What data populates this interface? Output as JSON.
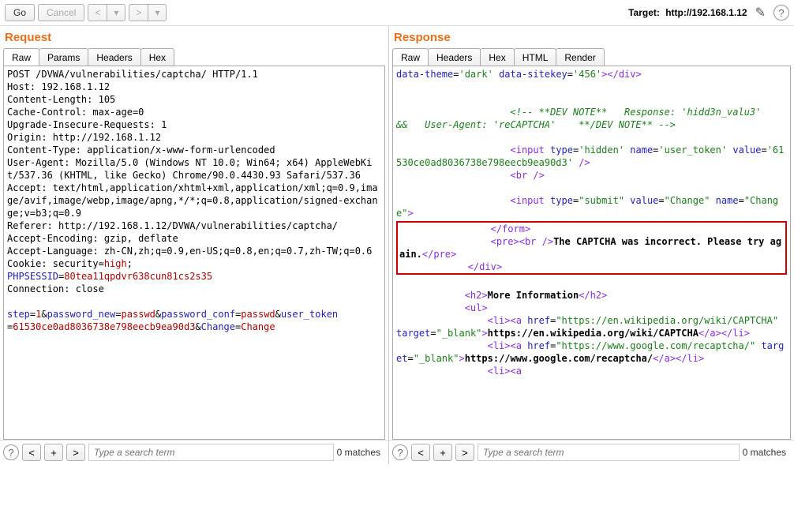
{
  "toolbar": {
    "go": "Go",
    "cancel": "Cancel",
    "target_label": "Target: ",
    "target_value": "http://192.168.1.12"
  },
  "request": {
    "title": "Request",
    "tabs": [
      "Raw",
      "Params",
      "Headers",
      "Hex"
    ],
    "active_tab": 0,
    "lines": [
      {
        "plain": "POST /DVWA/vulnerabilities/captcha/ HTTP/1.1"
      },
      {
        "plain": "Host: 192.168.1.12"
      },
      {
        "plain": "Content-Length: 105"
      },
      {
        "plain": "Cache-Control: max-age=0"
      },
      {
        "plain": "Upgrade-Insecure-Requests: 1"
      },
      {
        "plain": "Origin: http://192.168.1.12"
      },
      {
        "plain": "Content-Type: application/x-www-form-urlencoded"
      },
      {
        "plain": "User-Agent: Mozilla/5.0 (Windows NT 10.0; Win64; x64) AppleWebKit/537.36 (KHTML, like Gecko) Chrome/90.0.4430.93 Safari/537.36"
      },
      {
        "plain": "Accept: text/html,application/xhtml+xml,application/xml;q=0.9,image/avif,image/webp,image/apng,*/*;q=0.8,application/signed-exchange;v=b3;q=0.9"
      },
      {
        "plain": "Referer: http://192.168.1.12/DVWA/vulnerabilities/captcha/"
      },
      {
        "plain": "Accept-Encoding: gzip, deflate"
      },
      {
        "plain": "Accept-Language: zh-CN,zh;q=0.9,en-US;q=0.8,en;q=0.7,zh-TW;q=0.6"
      },
      {
        "cookie": {
          "prefix": "Cookie: security=",
          "sec": "high",
          "mid": "; ",
          "phpk": "PHPSESSID",
          "eq": "=",
          "phpv": "80tea11qpdvr638cun81cs2s35"
        }
      },
      {
        "plain": "Connection: close"
      },
      {
        "plain": ""
      },
      {
        "body": [
          {
            "k": "step",
            "v": "1"
          },
          {
            "k": "password_new",
            "v": "passwd"
          },
          {
            "k": "password_conf",
            "v": "passwd"
          },
          {
            "k": "user_token",
            "v": "61530ce0ad8036738e798eecb9ea90d3"
          },
          {
            "k": "Change",
            "v": "Change"
          }
        ]
      }
    ],
    "search_placeholder": "Type a search term",
    "matches": "0 matches"
  },
  "response": {
    "title": "Response",
    "tabs": [
      "Raw",
      "Headers",
      "Hex",
      "HTML",
      "Render"
    ],
    "active_tab": 0,
    "search_placeholder": "Type a search term",
    "matches": "0 matches",
    "comment": "<!-- **DEV NOTE**   Response: 'hidd3n_valu3'    &&   User-Agent: 'reCAPTCHA'    **/DEV NOTE** -->",
    "token_value": "61530ce0ad8036738e798eecb9ea90d3",
    "captcha_msg": "The CAPTCHA was incorrect. Please try again.",
    "more_info": "More Information",
    "link1": "https://en.wikipedia.org/wiki/CAPTCHA",
    "link2": "https://www.google.com/recaptcha/",
    "sitekey": "456",
    "theme": "dark"
  }
}
